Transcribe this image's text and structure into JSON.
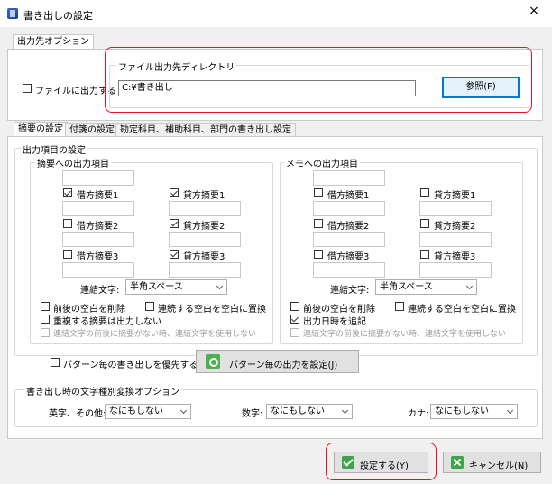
{
  "window": {
    "title": "書き出しの設定",
    "close_glyph": "×"
  },
  "output_tab": {
    "label": "出力先オプション"
  },
  "output": {
    "checkbox_label": "ファイルに出力する",
    "dir_group_label": "ファイル出力先ディレクトリ",
    "dir_value": "C:¥書き出し",
    "browse_label": "参照(F)"
  },
  "tabs": [
    {
      "label": "摘要の設定"
    },
    {
      "label": "付箋の設定"
    },
    {
      "label": "勘定科目、補助科目、部門の書き出し設定"
    }
  ],
  "output_items_group": "出力項目の設定",
  "summary": {
    "group_label": "摘要への出力項目",
    "items": [
      {
        "label": "借方摘要1",
        "checked": true
      },
      {
        "label": "貸方摘要1",
        "checked": true
      },
      {
        "label": "借方摘要2",
        "checked": false
      },
      {
        "label": "貸方摘要2",
        "checked": true
      },
      {
        "label": "借方摘要3",
        "checked": false
      },
      {
        "label": "貸方摘要3",
        "checked": true
      }
    ],
    "join_label": "連結文字:",
    "join_value": "半角スペース",
    "opt_trim": "前後の空白を削除",
    "opt_replace": "連続する空白を空白に置換",
    "opt_dup": "重複する摘要は出力しない",
    "opt_join_disabled": "連結文字の前後に摘要がない時、連結文字を使用しない"
  },
  "memo": {
    "group_label": "メモへの出力項目",
    "items": [
      {
        "label": "借方摘要1",
        "checked": false
      },
      {
        "label": "貸方摘要1",
        "checked": false
      },
      {
        "label": "借方摘要2",
        "checked": false
      },
      {
        "label": "貸方摘要2",
        "checked": false
      },
      {
        "label": "借方摘要3",
        "checked": false
      },
      {
        "label": "貸方摘要3",
        "checked": false
      }
    ],
    "join_label": "連結文字:",
    "join_value": "半角スペース",
    "opt_trim": "前後の空白を削除",
    "opt_replace": "連続する空白を空白に置換",
    "opt_date": "出力日時を追記",
    "opt_join_disabled": "連結文字の前後に摘要がない時、連結文字を使用しない"
  },
  "pattern": {
    "checkbox_label": "パターン毎の書き出しを優先する",
    "button_label": "パターン毎の出力を設定(J)"
  },
  "convert": {
    "group_label": "書き出し時の文字種別変換オプション",
    "alpha_label": "英字、その他:",
    "alpha_value": "なにもしない",
    "digit_label": "数字:",
    "digit_value": "なにもしない",
    "kana_label": "カナ:",
    "kana_value": "なにもしない"
  },
  "footer": {
    "ok_label": "設定する(Y)",
    "cancel_label": "キャンセル(N)"
  },
  "colors": {
    "highlight_ring": "#e81123",
    "focus": "#0078d7",
    "icon_green": "#3fa34d"
  }
}
